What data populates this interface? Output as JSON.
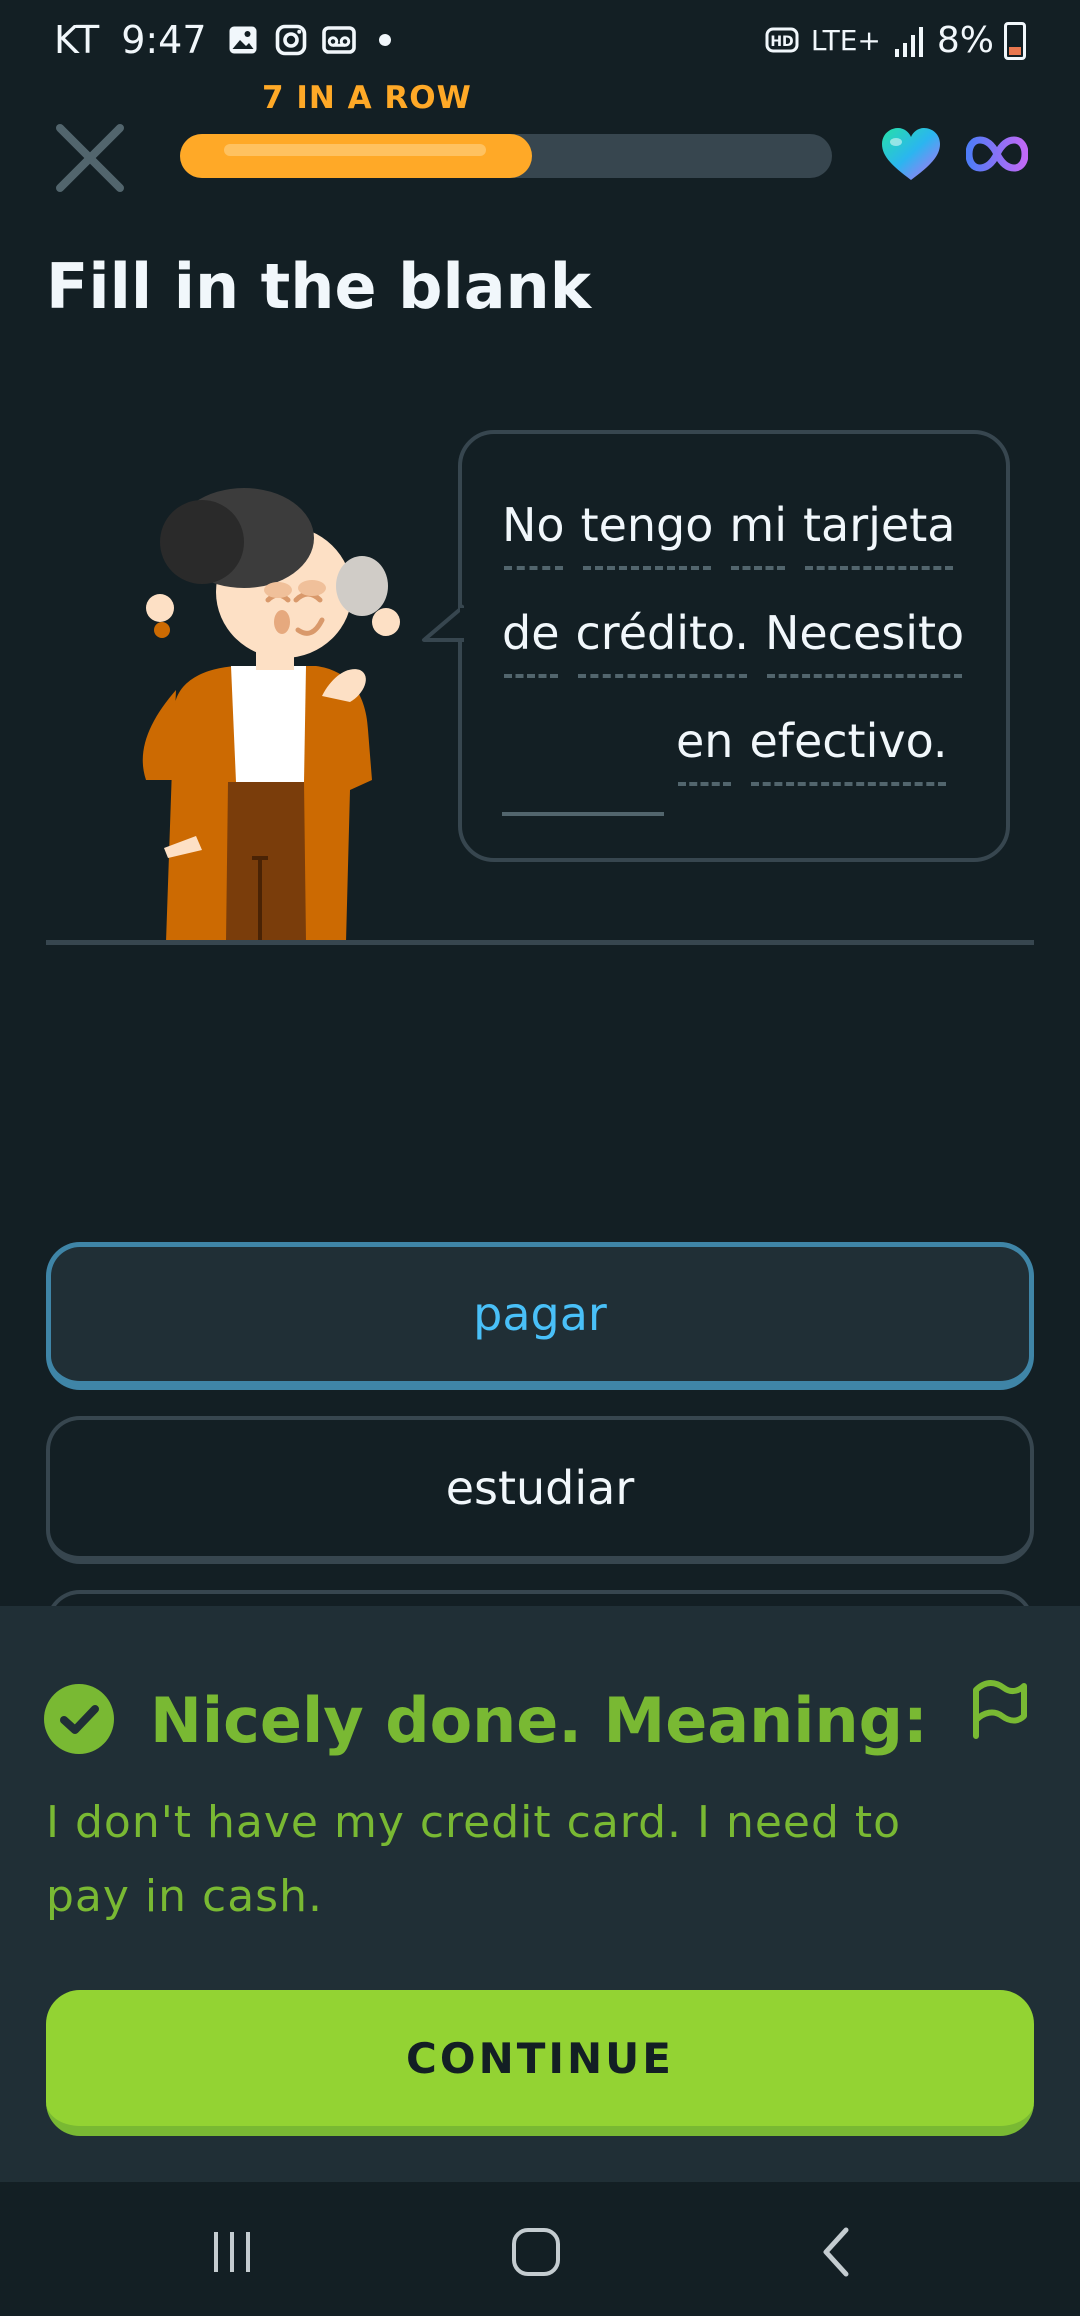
{
  "status_bar": {
    "carrier": "KT",
    "time": "9:47",
    "network": "LTE+",
    "hd_label": "HD",
    "battery": "8%",
    "icons": [
      "gallery-icon",
      "instagram-icon",
      "voicemail-icon",
      "dot-icon",
      "hd-voice-icon",
      "lte-icon",
      "signal-icon",
      "battery-icon"
    ]
  },
  "header": {
    "streak_label": "7 IN A ROW",
    "progress_fraction": 0.54,
    "close_icon": "close-icon",
    "hearts_icon": "heart-icon",
    "hearts_value_icon": "infinity-icon"
  },
  "challenge": {
    "title": "Fill in the blank",
    "prompt_lines": [
      [
        "No",
        "tengo",
        "mi",
        "tarjeta"
      ],
      [
        "de",
        "crédito.",
        "Necesito"
      ],
      [
        "en",
        "efectivo."
      ]
    ]
  },
  "options": [
    {
      "label": "pagar",
      "state": "selected"
    },
    {
      "label": "estudiar",
      "state": "default"
    }
  ],
  "feedback": {
    "title": "Nicely done. Meaning:",
    "meaning": "I don't have my credit card. I need to pay in cash.",
    "continue_label": "CONTINUE"
  },
  "colors": {
    "background": "#131f24",
    "streak_orange": "#ffa927",
    "selected_blue": "#49c0f8",
    "success_green": "#79b933",
    "continue_green": "#93d333",
    "panel": "#202f36"
  }
}
